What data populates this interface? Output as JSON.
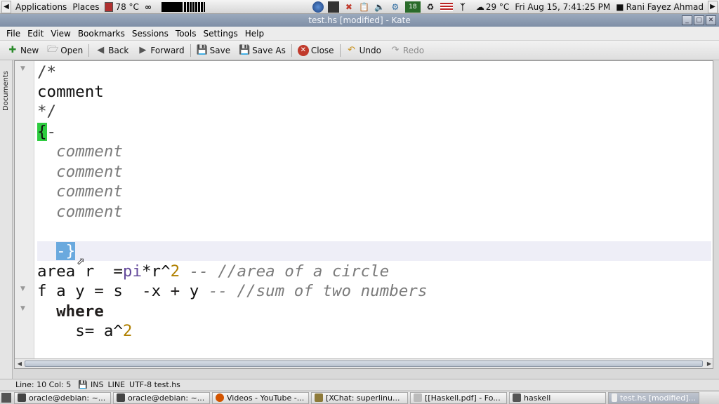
{
  "top_panel": {
    "applications": "Applications",
    "places": "Places",
    "weather": "78 °C",
    "temperature": "29 °C",
    "datetime": "Fri Aug 15,  7:41:25 PM",
    "user": "Rani Fayez Ahmad"
  },
  "window": {
    "title": "test.hs [modified] - Kate"
  },
  "menu": [
    "File",
    "Edit",
    "View",
    "Bookmarks",
    "Sessions",
    "Tools",
    "Settings",
    "Help"
  ],
  "toolbar": {
    "new": "New",
    "open": "Open",
    "back": "Back",
    "forward": "Forward",
    "save": "Save",
    "save_as": "Save As",
    "close": "Close",
    "undo": "Undo",
    "redo": "Redo"
  },
  "sidebar": {
    "documents_tab": "Documents"
  },
  "editor": {
    "line1": "/*",
    "line2": "comment",
    "line3": "*/",
    "line4_bracket": "{",
    "line4_rest": "-",
    "comment_line": "comment",
    "line10_bracket": "-}",
    "area_name": "area r  ",
    "area_eq": "=",
    "area_pi": "pi",
    "area_mul": "*r^",
    "area_num": "2",
    "area_comment": " -- //area of a circle",
    "f_lhs": "f a y ",
    "f_eq": "=",
    "f_rhs": " s  ",
    "f_minus": "-",
    "f_x": "x ",
    "f_plus": "+",
    "f_y": " y",
    "f_comment": " -- //sum of two numbers",
    "where": "where",
    "s_def": "s= a^",
    "s_num": "2"
  },
  "status": {
    "position": "Line: 10 Col: 5",
    "mode": "INS",
    "select_mode": "LINE",
    "encoding_file": "UTF-8 test.hs"
  },
  "taskbar": [
    "oracle@debian: ~...",
    "oracle@debian: ~...",
    "Videos - YouTube -...",
    "[XChat: superlinu...",
    "[[Haskell.pdf] - Fo...",
    "haskell",
    "test.hs [modified]..."
  ]
}
